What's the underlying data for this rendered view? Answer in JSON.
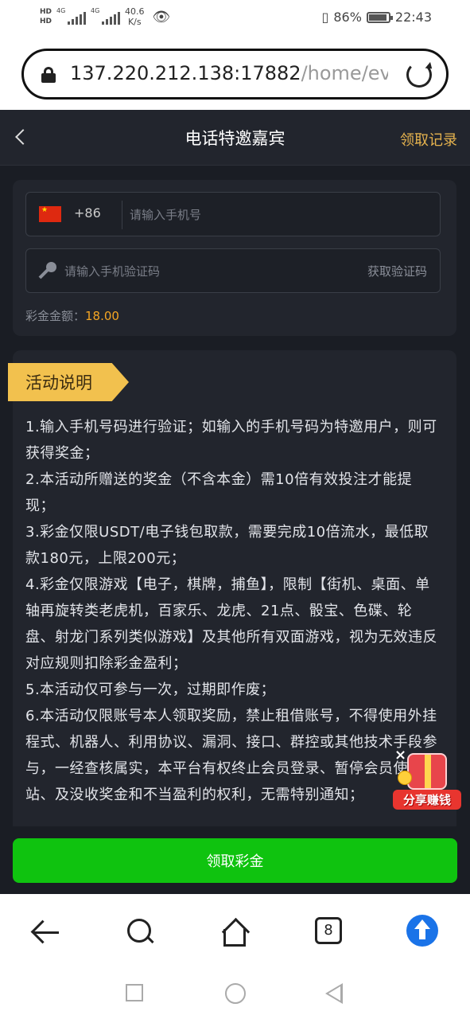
{
  "status_bar": {
    "hd1": "HD",
    "hd2": "HD",
    "net1": "4G",
    "net2": "4G",
    "speed_value": "40.6",
    "speed_unit": "K/s",
    "battery_percent": "86%",
    "time": "22:43"
  },
  "browser": {
    "url_host": "137.220.212.138:17882",
    "url_path": "/home/eve",
    "tab_count": "8"
  },
  "header": {
    "title": "电话特邀嘉宾",
    "records_label": "领取记录"
  },
  "form": {
    "country_code": "+86",
    "phone_placeholder": "请输入手机号",
    "code_placeholder": "请输入手机验证码",
    "get_code_label": "获取验证码",
    "bonus_label": "彩金金额：",
    "bonus_amount": "18.00"
  },
  "description": {
    "heading": "活动说明",
    "rules": [
      "1.输入手机号码进行验证；如输入的手机号码为特邀用户，则可获得奖金；",
      "2.本活动所赠送的奖金（不含本金）需10倍有效投注才能提现；",
      "3.彩金仅限USDT/电子钱包取款，需要完成10倍流水，最低取款180元，上限200元；",
      "4.彩金仅限游戏【电子，棋牌，捕鱼】，限制【街机、桌面、单轴再旋转类老虎机，百家乐、龙虎、21点、骰宝、色碟、轮盘、射龙门系列类似游戏】及其他所有双面游戏，视为无效违反对应规则扣除彩金盈利；",
      "5.本活动仅可参与一次，过期即作废；",
      "6.本活动仅限账号本人领取奖励，禁止租借账号，不得使用外挂程式、机器人、利用协议、漏洞、接口、群控或其他技术手段参与，一经查核属实，本平台有权终止会员登录、暂停会员使用网站、及没收奖金和不当盈利的权利，无需特别通知；"
    ]
  },
  "floating": {
    "close": "×",
    "label": "分享赚钱"
  },
  "claim_button": "领取彩金",
  "colors": {
    "accent_gold": "#e6b34e",
    "bonus_amount": "#f5a623",
    "claim_green": "#0fc30f",
    "background": "#1a1d24"
  }
}
